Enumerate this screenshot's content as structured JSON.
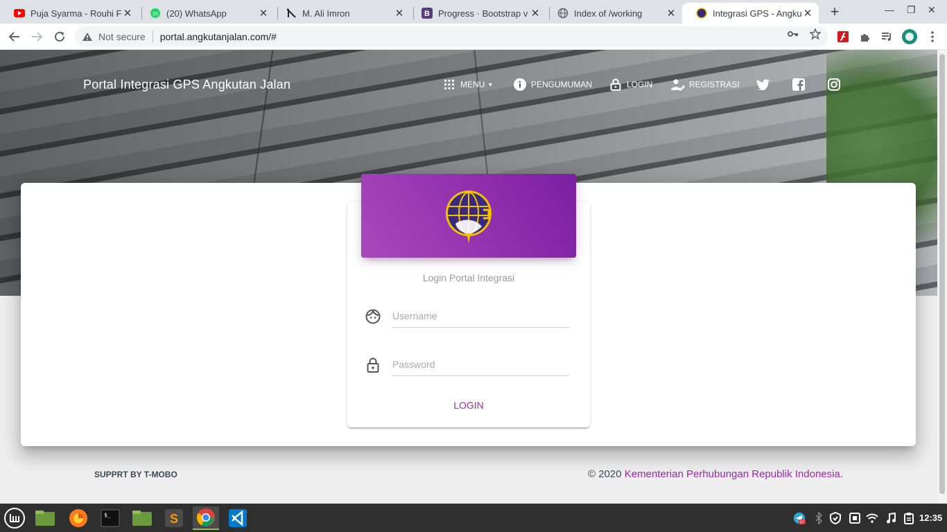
{
  "browser": {
    "tabs": [
      {
        "title": "Puja Syarma - Rouhi Fi",
        "icon": "youtube-icon"
      },
      {
        "title": "(20) WhatsApp",
        "icon": "whatsapp-icon"
      },
      {
        "title": "M. Ali Imron",
        "icon": "page-icon"
      },
      {
        "title": "Progress · Bootstrap v",
        "icon": "bootstrap-icon"
      },
      {
        "title": "Index of /working",
        "icon": "globe-icon"
      },
      {
        "title": "Integrasi GPS - Angkut",
        "icon": "emblem-icon",
        "active": true
      }
    ],
    "security_label": "Not secure",
    "url": "portal.angkutanjalan.com/#"
  },
  "page": {
    "brand": "Portal Integrasi GPS Angkutan Jalan",
    "nav": {
      "menu": "Menu",
      "pengumuman": "Pengumuman",
      "login": "Login",
      "registrasi": "Registrasi"
    },
    "login": {
      "subtitle": "Login Portal Integrasi",
      "username_placeholder": "Username",
      "password_placeholder": "Password",
      "button": "Login"
    },
    "footer": {
      "support": "SUPPRT BY T-MOBO",
      "copyright_prefix": "© 2020 ",
      "copyright_link": "Kementerian Perhubungan Republik Indonesia."
    }
  },
  "taskbar": {
    "clock": "12:35",
    "telegram_badge": "67"
  },
  "colors": {
    "accent": "#9c27b0",
    "header_gradient_start": "#ab47bc",
    "header_gradient_end": "#7b1fa2"
  }
}
